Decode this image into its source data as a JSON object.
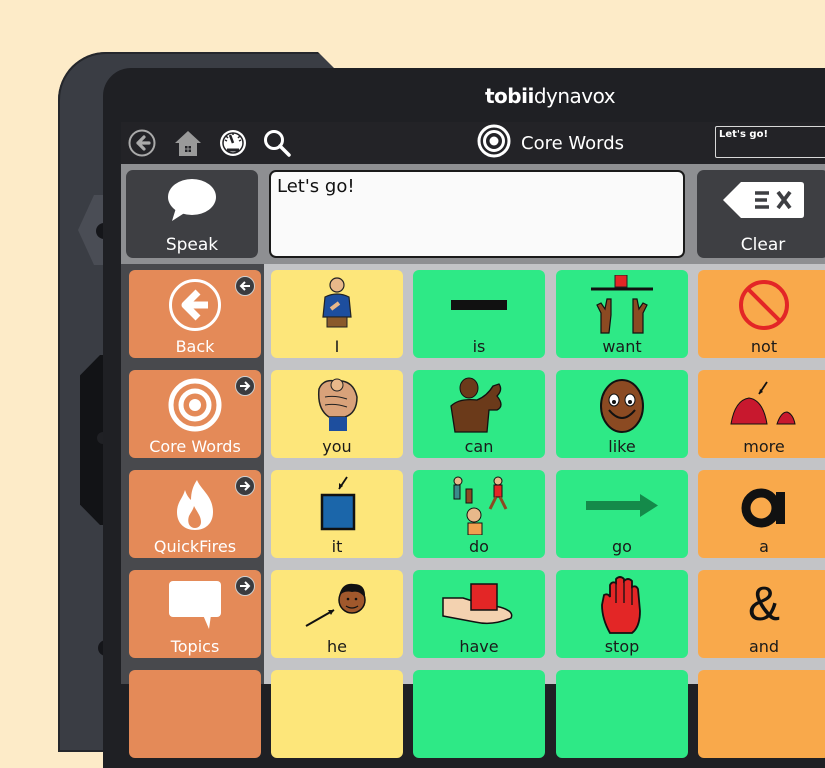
{
  "device": {
    "brand_bold": "tobii",
    "brand_rest": "dynavox"
  },
  "topbar": {
    "icons": [
      "back-circle-icon",
      "home-icon",
      "dashboard-icon",
      "search-icon"
    ],
    "page_icon": "target-icon",
    "page_title": "Core Words",
    "message_preview": "Let's go!"
  },
  "message_bar": {
    "speak_label": "Speak",
    "speak_icon": "speech-bubble-icon",
    "message_text": "Let's go!",
    "clear_label": "Clear",
    "clear_icon": "clear-backspace-icon"
  },
  "nav_buttons": [
    {
      "label": "Back",
      "icon": "arrow-left-circle-icon",
      "corner_icon": "arrow-left-icon"
    },
    {
      "label": "Core Words",
      "icon": "target-icon",
      "corner_icon": "arrow-right-icon"
    },
    {
      "label": "QuickFires",
      "icon": "flame-icon",
      "corner_icon": "arrow-right-icon"
    },
    {
      "label": "Topics",
      "icon": "speech-bubble-square-icon",
      "corner_icon": "arrow-right-icon"
    }
  ],
  "grid": {
    "rows": [
      [
        {
          "word": "I",
          "color": "yellow",
          "symbol": "person-pointing-self-icon"
        },
        {
          "word": "is",
          "color": "green",
          "symbol": "black-bar-icon"
        },
        {
          "word": "want",
          "color": "green",
          "symbol": "hands-reaching-icon"
        },
        {
          "word": "not",
          "color": "orange",
          "symbol": "prohibited-icon"
        }
      ],
      [
        {
          "word": "you",
          "color": "yellow",
          "symbol": "finger-pointing-icon"
        },
        {
          "word": "can",
          "color": "green",
          "symbol": "flexing-arm-icon"
        },
        {
          "word": "like",
          "color": "green",
          "symbol": "smiling-face-icon"
        },
        {
          "word": "more",
          "color": "orange",
          "symbol": "pile-of-berries-icon"
        }
      ],
      [
        {
          "word": "it",
          "color": "yellow",
          "symbol": "blue-square-arrow-icon"
        },
        {
          "word": "do",
          "color": "green",
          "symbol": "people-activities-icon"
        },
        {
          "word": "go",
          "color": "green",
          "symbol": "arrow-right-icon"
        },
        {
          "word": "a",
          "color": "orange",
          "symbol": "letter-a-icon"
        }
      ],
      [
        {
          "word": "he",
          "color": "yellow",
          "symbol": "boy-face-arrow-icon"
        },
        {
          "word": "have",
          "color": "green",
          "symbol": "hand-holding-square-icon"
        },
        {
          "word": "stop",
          "color": "green",
          "symbol": "red-hand-icon"
        },
        {
          "word": "and",
          "color": "orange",
          "symbol": "ampersand-icon"
        }
      ]
    ]
  },
  "colors": {
    "nav": "#e48a58",
    "yellow": "#fde67a",
    "green": "#2ee986",
    "orange": "#f9a94b",
    "topbar": "#232327",
    "background": "#fdebc8"
  }
}
